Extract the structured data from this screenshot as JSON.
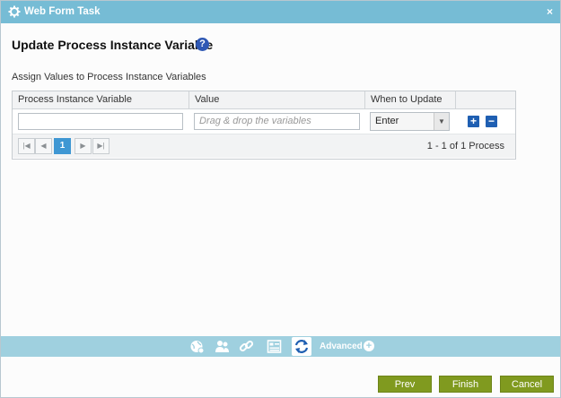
{
  "window": {
    "title": "Web Form Task",
    "close_label": "×"
  },
  "page": {
    "heading": "Update Process Instance Variable",
    "help_label": "?",
    "section_label": "Assign Values to Process Instance Variables"
  },
  "grid": {
    "columns": [
      "Process Instance Variable",
      "Value",
      "When to Update",
      ""
    ],
    "rows": [
      {
        "variable": "",
        "value_placeholder": "Drag & drop the variables",
        "when": "Enter"
      }
    ],
    "add_label": "+",
    "remove_label": "−"
  },
  "pager": {
    "first": "|◀",
    "prev": "◀",
    "current": "1",
    "next": "▶",
    "last": "▶|",
    "info": "1 - 1 of 1 Process"
  },
  "bottombar": {
    "icons": [
      "globe-icon",
      "users-icon",
      "link-icon",
      "form-icon",
      "refresh-icon"
    ],
    "advanced_label": "Advanced",
    "advanced_plus": "+"
  },
  "buttons": {
    "prev": "Prev",
    "finish": "Finish",
    "cancel": "Cancel"
  },
  "colors": {
    "titlebar": "#76bcd5",
    "bottombar": "#9fd0df",
    "button": "#809a1f",
    "accent": "#1f5fb2"
  }
}
